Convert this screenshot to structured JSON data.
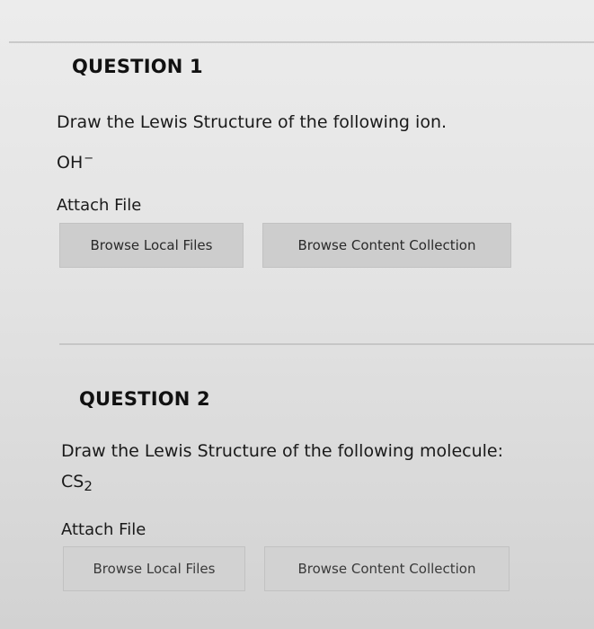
{
  "question1": {
    "title": "QUESTION 1",
    "prompt": "Draw the Lewis Structure of the following ion.",
    "formula_base": "OH",
    "formula_charge": "−",
    "attach_label": "Attach File",
    "browse_local_label": "Browse Local Files",
    "browse_content_label": "Browse Content Collection"
  },
  "question2": {
    "title": "QUESTION 2",
    "prompt": "Draw the Lewis Structure of the following molecule:",
    "formula_base": "CS",
    "formula_subscript": "2",
    "attach_label": "Attach File",
    "browse_local_label": "Browse Local Files",
    "browse_content_label": "Browse Content Collection"
  }
}
